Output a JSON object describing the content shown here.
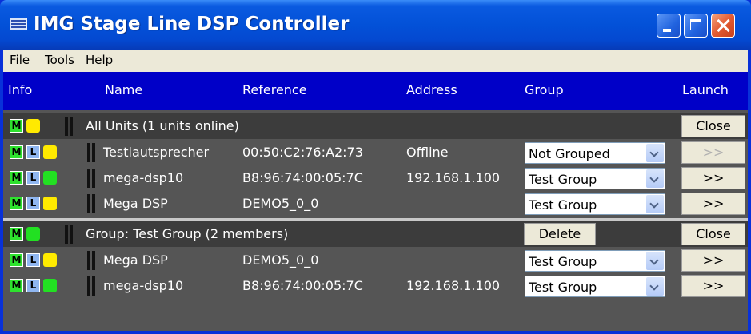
{
  "window": {
    "title": "IMG Stage Line DSP Controller"
  },
  "menu": {
    "items": [
      "File",
      "Tools",
      "Help"
    ]
  },
  "columns": {
    "info": "Info",
    "name": "Name",
    "reference": "Reference",
    "address": "Address",
    "group": "Group",
    "launch": "Launch"
  },
  "all_units": {
    "label": "All Units (1 units online)",
    "status": "yellow",
    "close_label": "Close",
    "rows": [
      {
        "name": "Testlautsprecher",
        "reference": "00:50:C2:76:A2:73",
        "address": "Offline",
        "group": "Not Grouped",
        "launch": ">>",
        "status": "yellow",
        "launch_enabled": false
      },
      {
        "name": "mega-dsp10",
        "reference": "B8:96:74:00:05:7C",
        "address": "192.168.1.100",
        "group": "Test Group",
        "launch": ">>",
        "status": "green",
        "launch_enabled": true
      },
      {
        "name": "Mega DSP",
        "reference": "DEMO5_0_0",
        "address": "",
        "group": "Test Group",
        "launch": ">>",
        "status": "yellow",
        "launch_enabled": true
      }
    ]
  },
  "test_group": {
    "label": "Group: Test Group (2 members)",
    "status": "green",
    "delete_label": "Delete",
    "close_label": "Close",
    "rows": [
      {
        "name": "Mega DSP",
        "reference": "DEMO5_0_0",
        "address": "",
        "group": "Test Group",
        "launch": ">>",
        "status": "yellow",
        "launch_enabled": true
      },
      {
        "name": "mega-dsp10",
        "reference": "B8:96:74:00:05:7C",
        "address": "192.168.1.100",
        "group": "Test Group",
        "launch": ">>",
        "status": "green",
        "launch_enabled": true
      }
    ]
  },
  "badges": {
    "m": "M",
    "l": "L"
  },
  "colors": {
    "header": "#0000c8",
    "row": "#555555",
    "group_row": "#3c3c3c",
    "led_yellow": "#ffea00",
    "led_green": "#22e022"
  }
}
